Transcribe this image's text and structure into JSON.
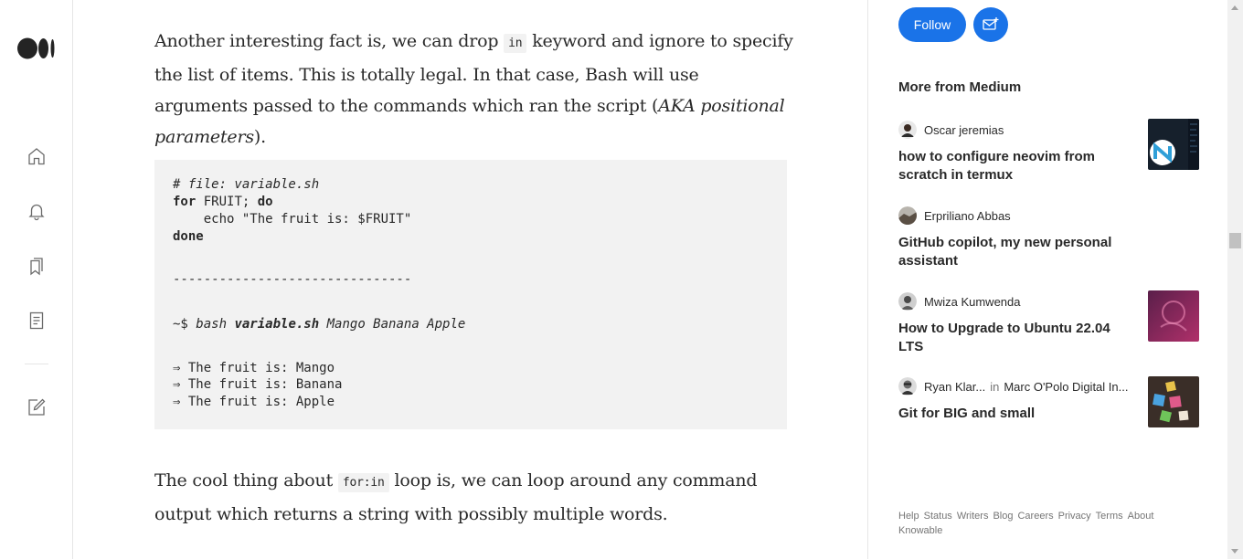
{
  "rail": {
    "icons": [
      "medium-logo",
      "home-icon",
      "bell-icon",
      "bookmarks-icon",
      "stories-icon",
      "write-icon"
    ]
  },
  "article": {
    "para1": {
      "a": "Another interesting fact is, we can drop ",
      "code": "in",
      "b": " keyword and ignore to specify the list of items. This is totally legal. In that case, Bash will use arguments passed to the commands which ran the script (",
      "em": "AKA positional parameters",
      "c": ")."
    },
    "code_block": {
      "line1": "# file: variable.sh",
      "line2_kw": "for",
      "line2_rest": " FRUIT; ",
      "line2_kw2": "do",
      "line3": "    echo \"The fruit is: $FRUIT\"",
      "line4": "done",
      "separator": "-------------------------------",
      "cmd_prompt": "~$ ",
      "cmd_bash": "bash",
      "cmd_file": "variable.sh",
      "cmd_args": "Mango Banana Apple",
      "out1": "⇒ The fruit is: Mango",
      "out2": "⇒ The fruit is: Banana",
      "out3": "⇒ The fruit is: Apple"
    },
    "para2": {
      "a": "The cool thing about ",
      "code": "for:in",
      "b": " loop is, we can loop around any command output which returns a string with possibly multiple words."
    }
  },
  "sidebar": {
    "follow_label": "Follow",
    "more_title": "More from Medium",
    "stories": [
      {
        "author": "Oscar jeremias",
        "title": "how to configure neovim from scratch in termux"
      },
      {
        "author": "Erpriliano Abbas",
        "title": "GitHub copilot, my new personal assistant"
      },
      {
        "author": "Mwiza Kumwenda",
        "title": "How to Upgrade to Ubuntu 22.04 LTS"
      },
      {
        "author": "Ryan Klar...",
        "in": "in",
        "publication": "Marc O'Polo Digital In...",
        "title": "Git for BIG and small"
      }
    ],
    "footer": [
      "Help",
      "Status",
      "Writers",
      "Blog",
      "Careers",
      "Privacy",
      "Terms",
      "About",
      "Knowable"
    ]
  },
  "colors": {
    "accent": "#1a73e8",
    "code_bg": "#f2f2f2",
    "text": "#292929"
  }
}
